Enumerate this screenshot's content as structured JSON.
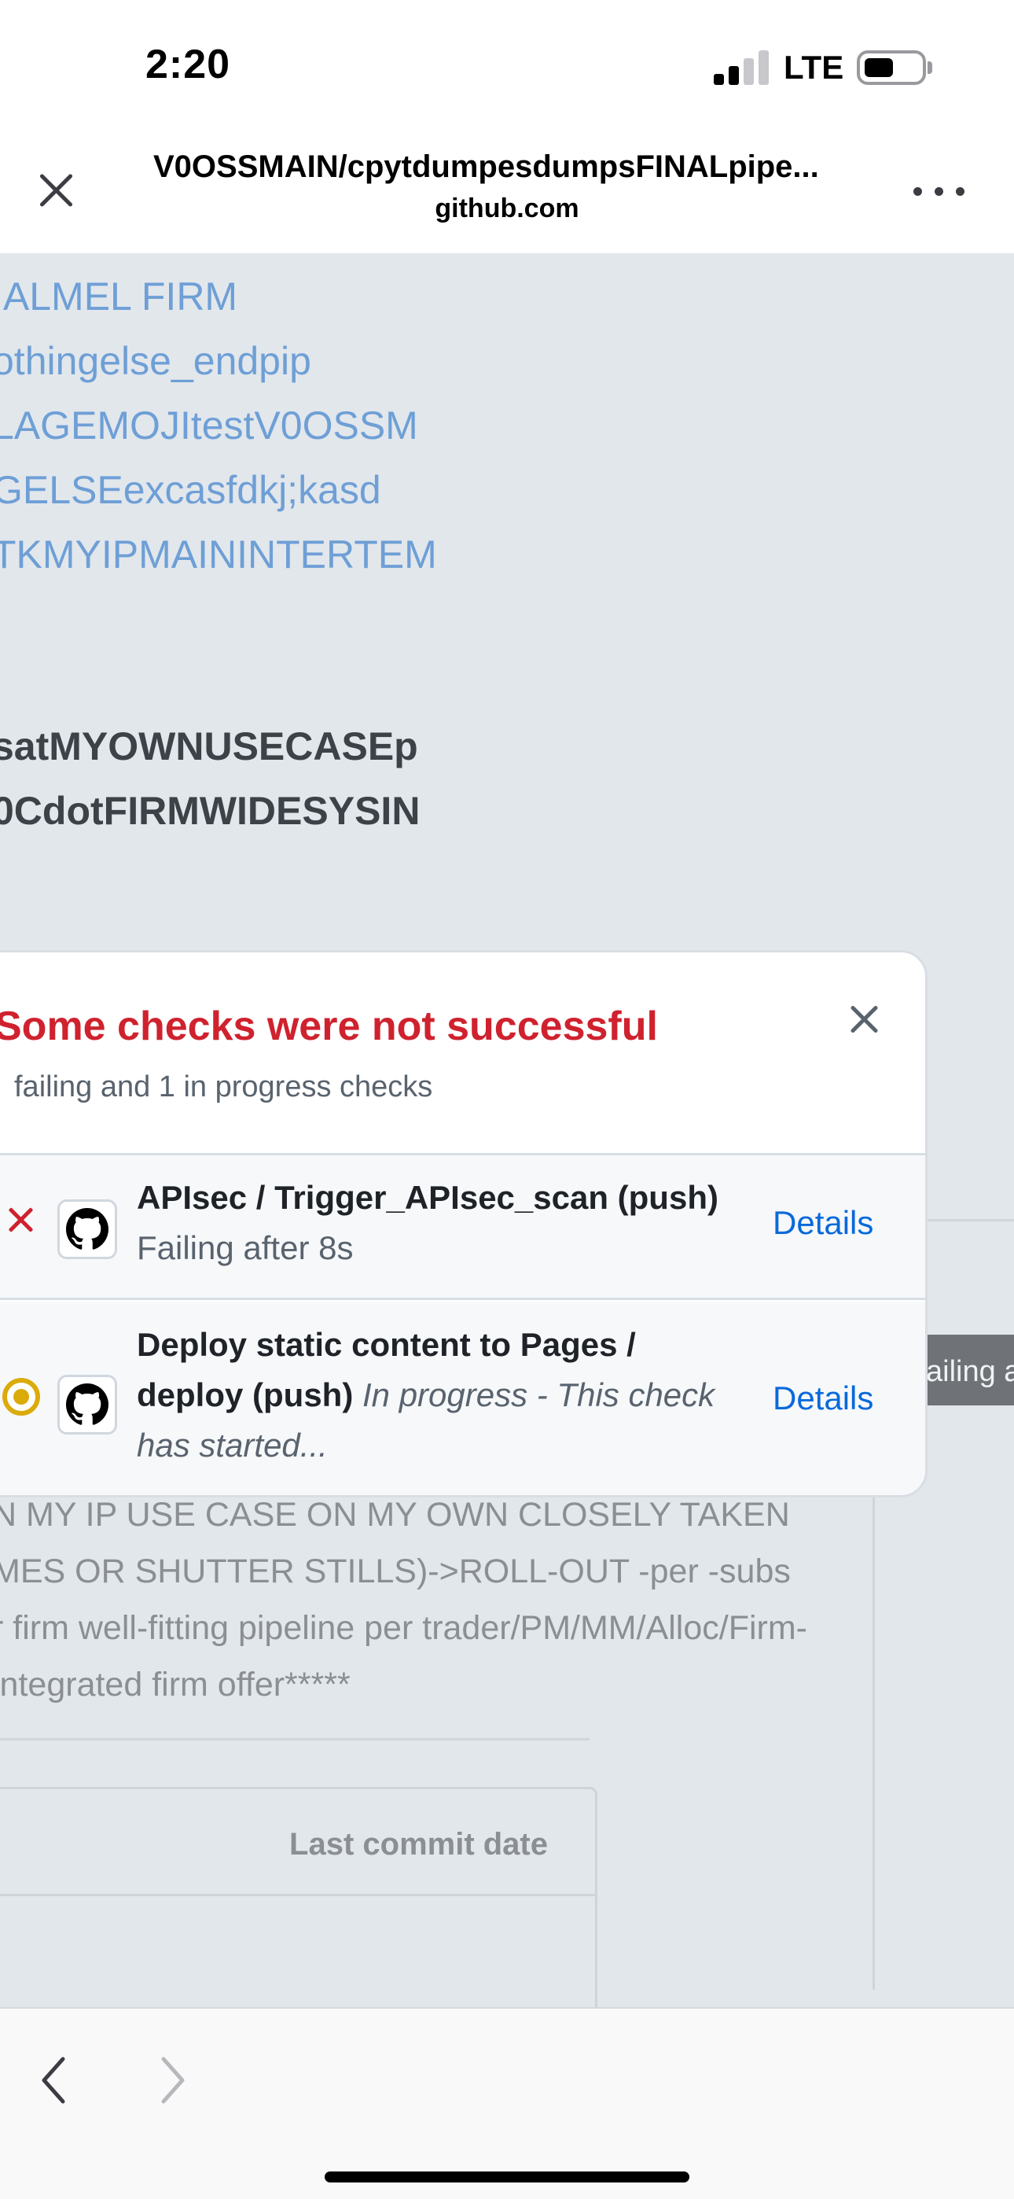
{
  "status_bar": {
    "time": "2:20",
    "network": "LTE"
  },
  "browser": {
    "title": "V0OSSMAIN/cpytdumpesdumpsFINALpipe...",
    "domain": "github.com",
    "close_icon": "close-icon",
    "more_icon": "more-horizontal-icon"
  },
  "page": {
    "link_lines": [
      "IALMEL FIRM",
      "othingelse_endpip",
      "LAGEMOJItestV0OSSM",
      "GELSEexcasfdkj;kasd",
      "TKMYIPMAININTERTEM"
    ],
    "bold_lines": [
      "satMYOWNUSECASEp",
      "0CdotFIRMWIDESYSIN"
    ],
    "description_lines": [
      "N MY IP USE CASE ON MY OWN CLOSELY TAKEN",
      "MES OR SHUTTER STILLS)->ROLL-OUT -per -subs",
      "r firm well-fitting pipeline per trader/PM/MM/Alloc/Firm-",
      " integrated firm offer*****"
    ],
    "failing_chip": "ailing a",
    "table_header": "Last commit date"
  },
  "checks_popover": {
    "title": "Some checks were not successful",
    "subtitle": " failing and 1 in progress checks",
    "checks": [
      {
        "name": "APIsec / Trigger_APIsec_scan (push)",
        "state": "Failing after 8s",
        "details": "Details",
        "status": "failure"
      },
      {
        "name": "Deploy static content to Pages / deploy (push)",
        "state": "In progress - This check has started...",
        "details": "Details",
        "status": "in_progress"
      }
    ]
  },
  "toolbar": {
    "back_icon": "chevron-left-icon",
    "forward_icon": "chevron-right-icon"
  },
  "colors": {
    "link": "#6e9fd6",
    "error": "#cf222e",
    "progress": "#dbab0a",
    "details_link": "#0969da"
  }
}
